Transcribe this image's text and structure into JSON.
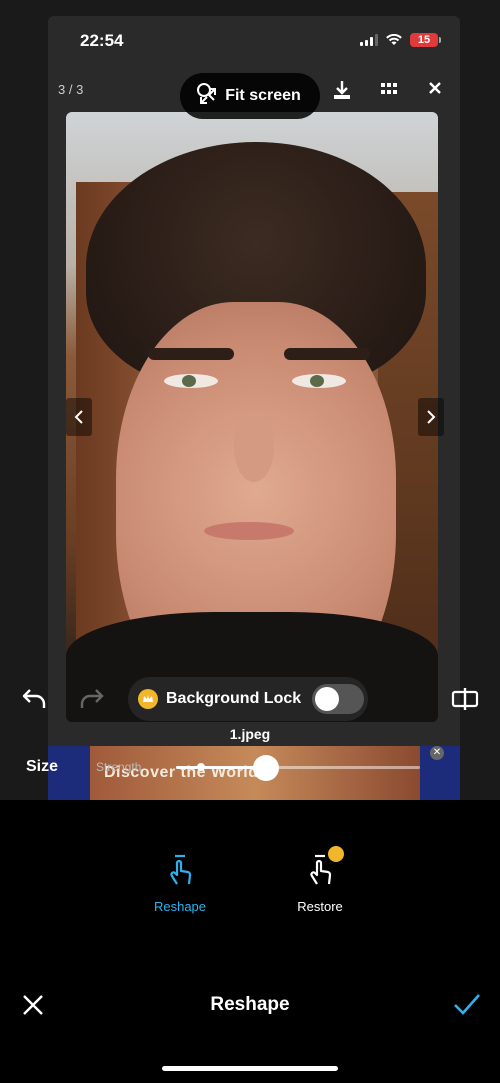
{
  "status": {
    "time": "22:54",
    "battery": "15"
  },
  "viewer": {
    "counter": "3 / 3",
    "fit_label": "Fit screen",
    "filename": "1.jpeg"
  },
  "background_lock": {
    "label": "Background Lock",
    "enabled": false
  },
  "ad": {
    "text": "Discover the World"
  },
  "size_control": {
    "label": "Size",
    "strength_label": "Strength",
    "value_fraction": 0.37
  },
  "tools": [
    {
      "label": "Reshape",
      "active": true
    },
    {
      "label": "Restore",
      "active": false
    }
  ],
  "bottom": {
    "title": "Reshape"
  },
  "colors": {
    "accent": "#2bb3f0",
    "crown": "#f1b62b",
    "battery_low": "#e23a3a"
  },
  "icons": [
    "signal-icon",
    "wifi-icon",
    "battery-icon",
    "zoom-icon",
    "expand-icon",
    "download-icon",
    "grid-icon",
    "close-icon",
    "chevron-left-icon",
    "chevron-right-icon",
    "undo-icon",
    "redo-icon",
    "compare-icon",
    "crown-icon",
    "reshape-hand-icon",
    "restore-hand-icon",
    "cancel-icon",
    "checkmark-icon"
  ]
}
